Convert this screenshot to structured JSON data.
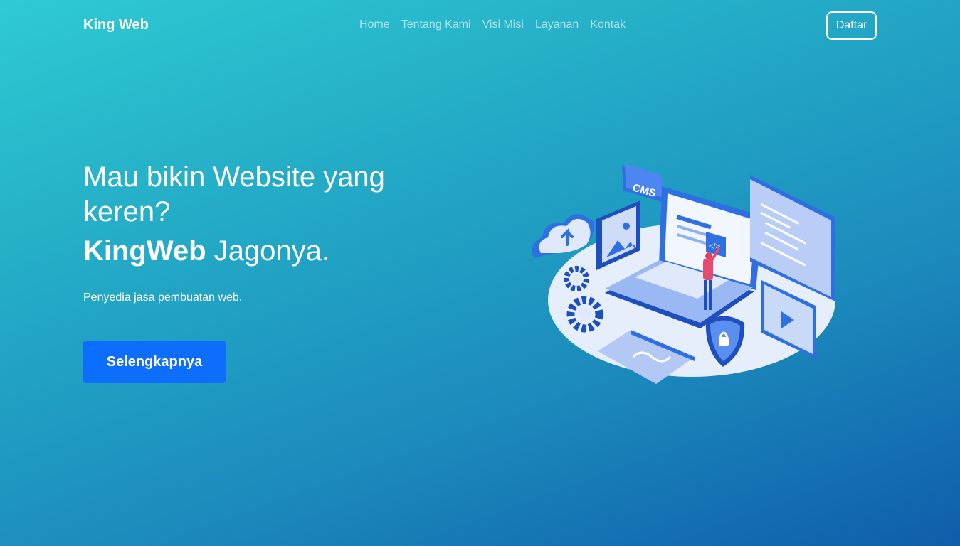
{
  "navbar": {
    "brand": "King Web",
    "links": [
      "Home",
      "Tentang Kami",
      "Visi Misi",
      "Layanan",
      "Kontak"
    ],
    "cta": "Daftar"
  },
  "hero": {
    "title": "Mau bikin Website yang keren?",
    "brand_strong": "KingWeb",
    "brand_rest": " Jagonya.",
    "description": "Penyedia jasa pembuatan web.",
    "button": "Selengkapnya"
  },
  "illustration": {
    "name": "isometric-web-development-illustration",
    "badge_text": "CMS",
    "code_text": "</>"
  },
  "colors": {
    "gradient_start": "#2ecad2",
    "gradient_end": "#0f5dab",
    "primary_button": "#0d6efd",
    "illustration_blue": "#2f6fe4",
    "illustration_light": "#dfe9fb"
  }
}
